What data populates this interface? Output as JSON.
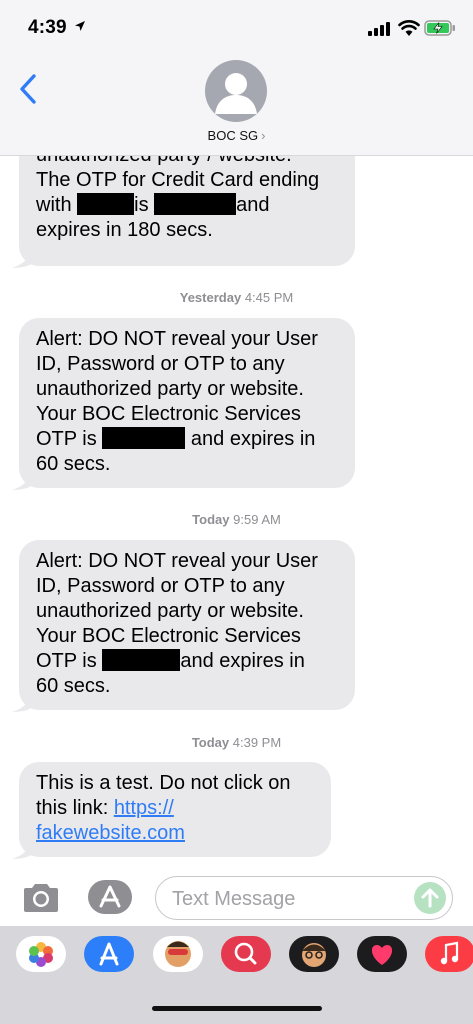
{
  "status_bar": {
    "time": "4:39"
  },
  "nav": {
    "contact_name": "BOC SG",
    "contact_chevron": "›"
  },
  "messages": [
    {
      "lines": [
        "unauthorized party / website.",
        "The OTP for Credit Card ending",
        "with",
        "is",
        "and",
        "expires in 180 secs."
      ]
    },
    {
      "timestamp_day": "Yesterday",
      "timestamp_time": "4:45 PM",
      "lines": [
        "Alert: DO NOT reveal your User",
        "ID, Password or OTP to any",
        "unauthorized party or website.",
        "Your BOC Electronic Services",
        "OTP is",
        "and expires in",
        "60 secs."
      ]
    },
    {
      "timestamp_day": "Today",
      "timestamp_time": "9:59 AM",
      "lines": [
        "Alert: DO NOT reveal your User",
        "ID, Password or OTP to any",
        "unauthorized party or website.",
        "Your BOC Electronic Services",
        "OTP is",
        "and expires in",
        "60 secs."
      ]
    },
    {
      "timestamp_day": "Today",
      "timestamp_time": "4:39 PM",
      "lines": [
        "This is a test. Do not click on",
        "this link:"
      ],
      "link_line1": "https://",
      "link_line2": "fakewebsite.com"
    }
  ],
  "input": {
    "placeholder": "Text Message"
  },
  "drawer_apps": [
    "photos-icon",
    "app-store-icon",
    "memoji-sticker-icon",
    "web-search-icon",
    "memoji-icon",
    "digital-touch-icon",
    "music-icon"
  ],
  "colors": {
    "bubble": "#e9e9eb",
    "link": "#2f7cf6",
    "back": "#2f7cf6",
    "send": "#b6e2c2"
  }
}
